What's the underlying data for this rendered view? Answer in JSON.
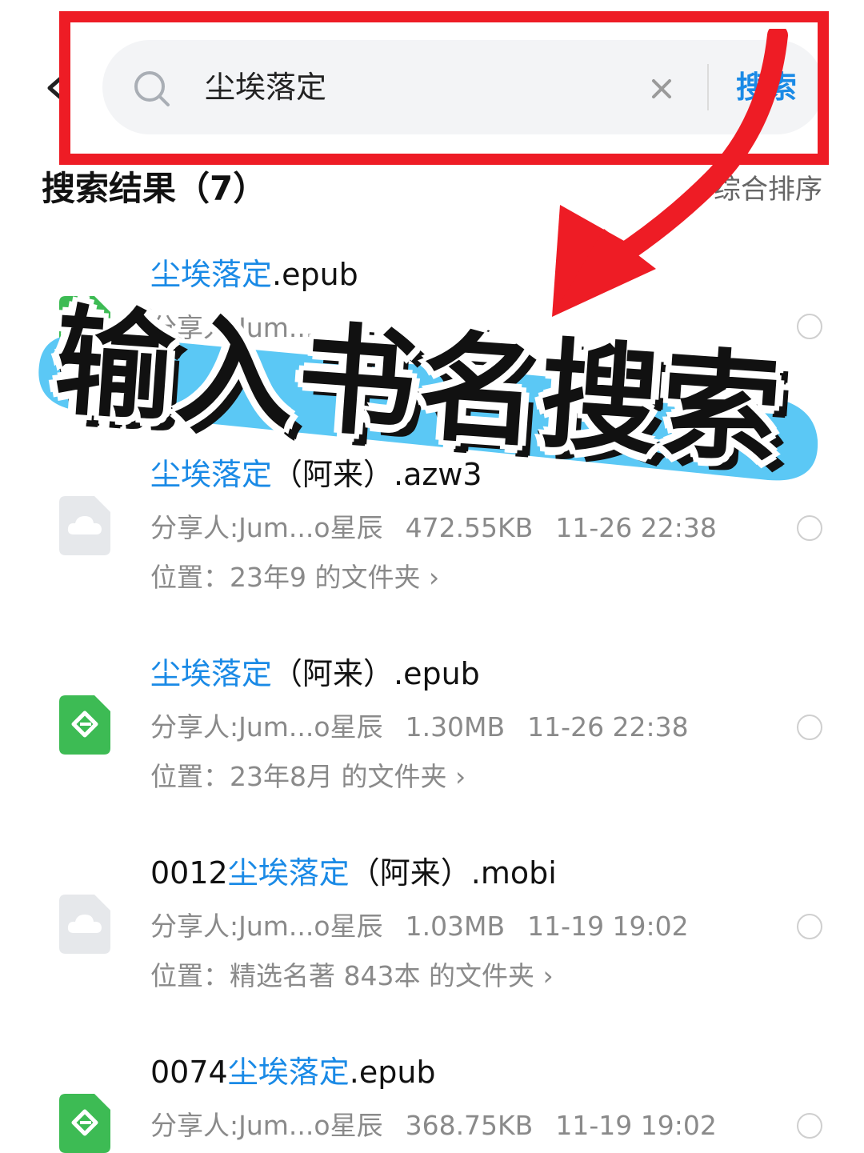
{
  "search": {
    "query": "尘埃落定",
    "submit_label": "搜索"
  },
  "results": {
    "title": "搜索结果（7）",
    "sort_label": "综合排序"
  },
  "overlay": {
    "banner_text": "输入书名搜索"
  },
  "items": [
    {
      "name_prefix": "",
      "name_highlight": "尘埃落定",
      "name_suffix": ".epub",
      "sharer": "分享人:Jum...",
      "size": "",
      "time": "",
      "location": "",
      "icon": "epub-file-icon",
      "partially_hidden": true
    },
    {
      "name_prefix": "",
      "name_highlight": "尘埃落定",
      "name_suffix": "（阿来）.azw3",
      "sharer": "分享人:Jum...o星辰",
      "size": "472.55KB",
      "time": "11-26 22:38",
      "location": "位置：23年9 的文件夹",
      "icon": "cloud-file-icon"
    },
    {
      "name_prefix": "",
      "name_highlight": "尘埃落定",
      "name_suffix": "（阿来）.epub",
      "sharer": "分享人:Jum...o星辰",
      "size": "1.30MB",
      "time": "11-26 22:38",
      "location": "位置：23年8月 的文件夹",
      "icon": "epub-file-icon"
    },
    {
      "name_prefix": "0012",
      "name_highlight": "尘埃落定",
      "name_suffix": "（阿来）.mobi",
      "sharer": "分享人:Jum...o星辰",
      "size": "1.03MB",
      "time": "11-19 19:02",
      "location": "位置：精选名著 843本 的文件夹",
      "icon": "cloud-file-icon"
    },
    {
      "name_prefix": "0074",
      "name_highlight": "尘埃落定",
      "name_suffix": ".epub",
      "sharer": "分享人:Jum...o星辰",
      "size": "368.75KB",
      "time": "11-19 19:02",
      "location": "",
      "icon": "epub-file-icon"
    }
  ],
  "colors": {
    "accent": "#1a8ae6",
    "highlight_frame": "#ee1c25",
    "banner_bg": "#5bc8f5",
    "epub_green": "#3dbb54"
  }
}
